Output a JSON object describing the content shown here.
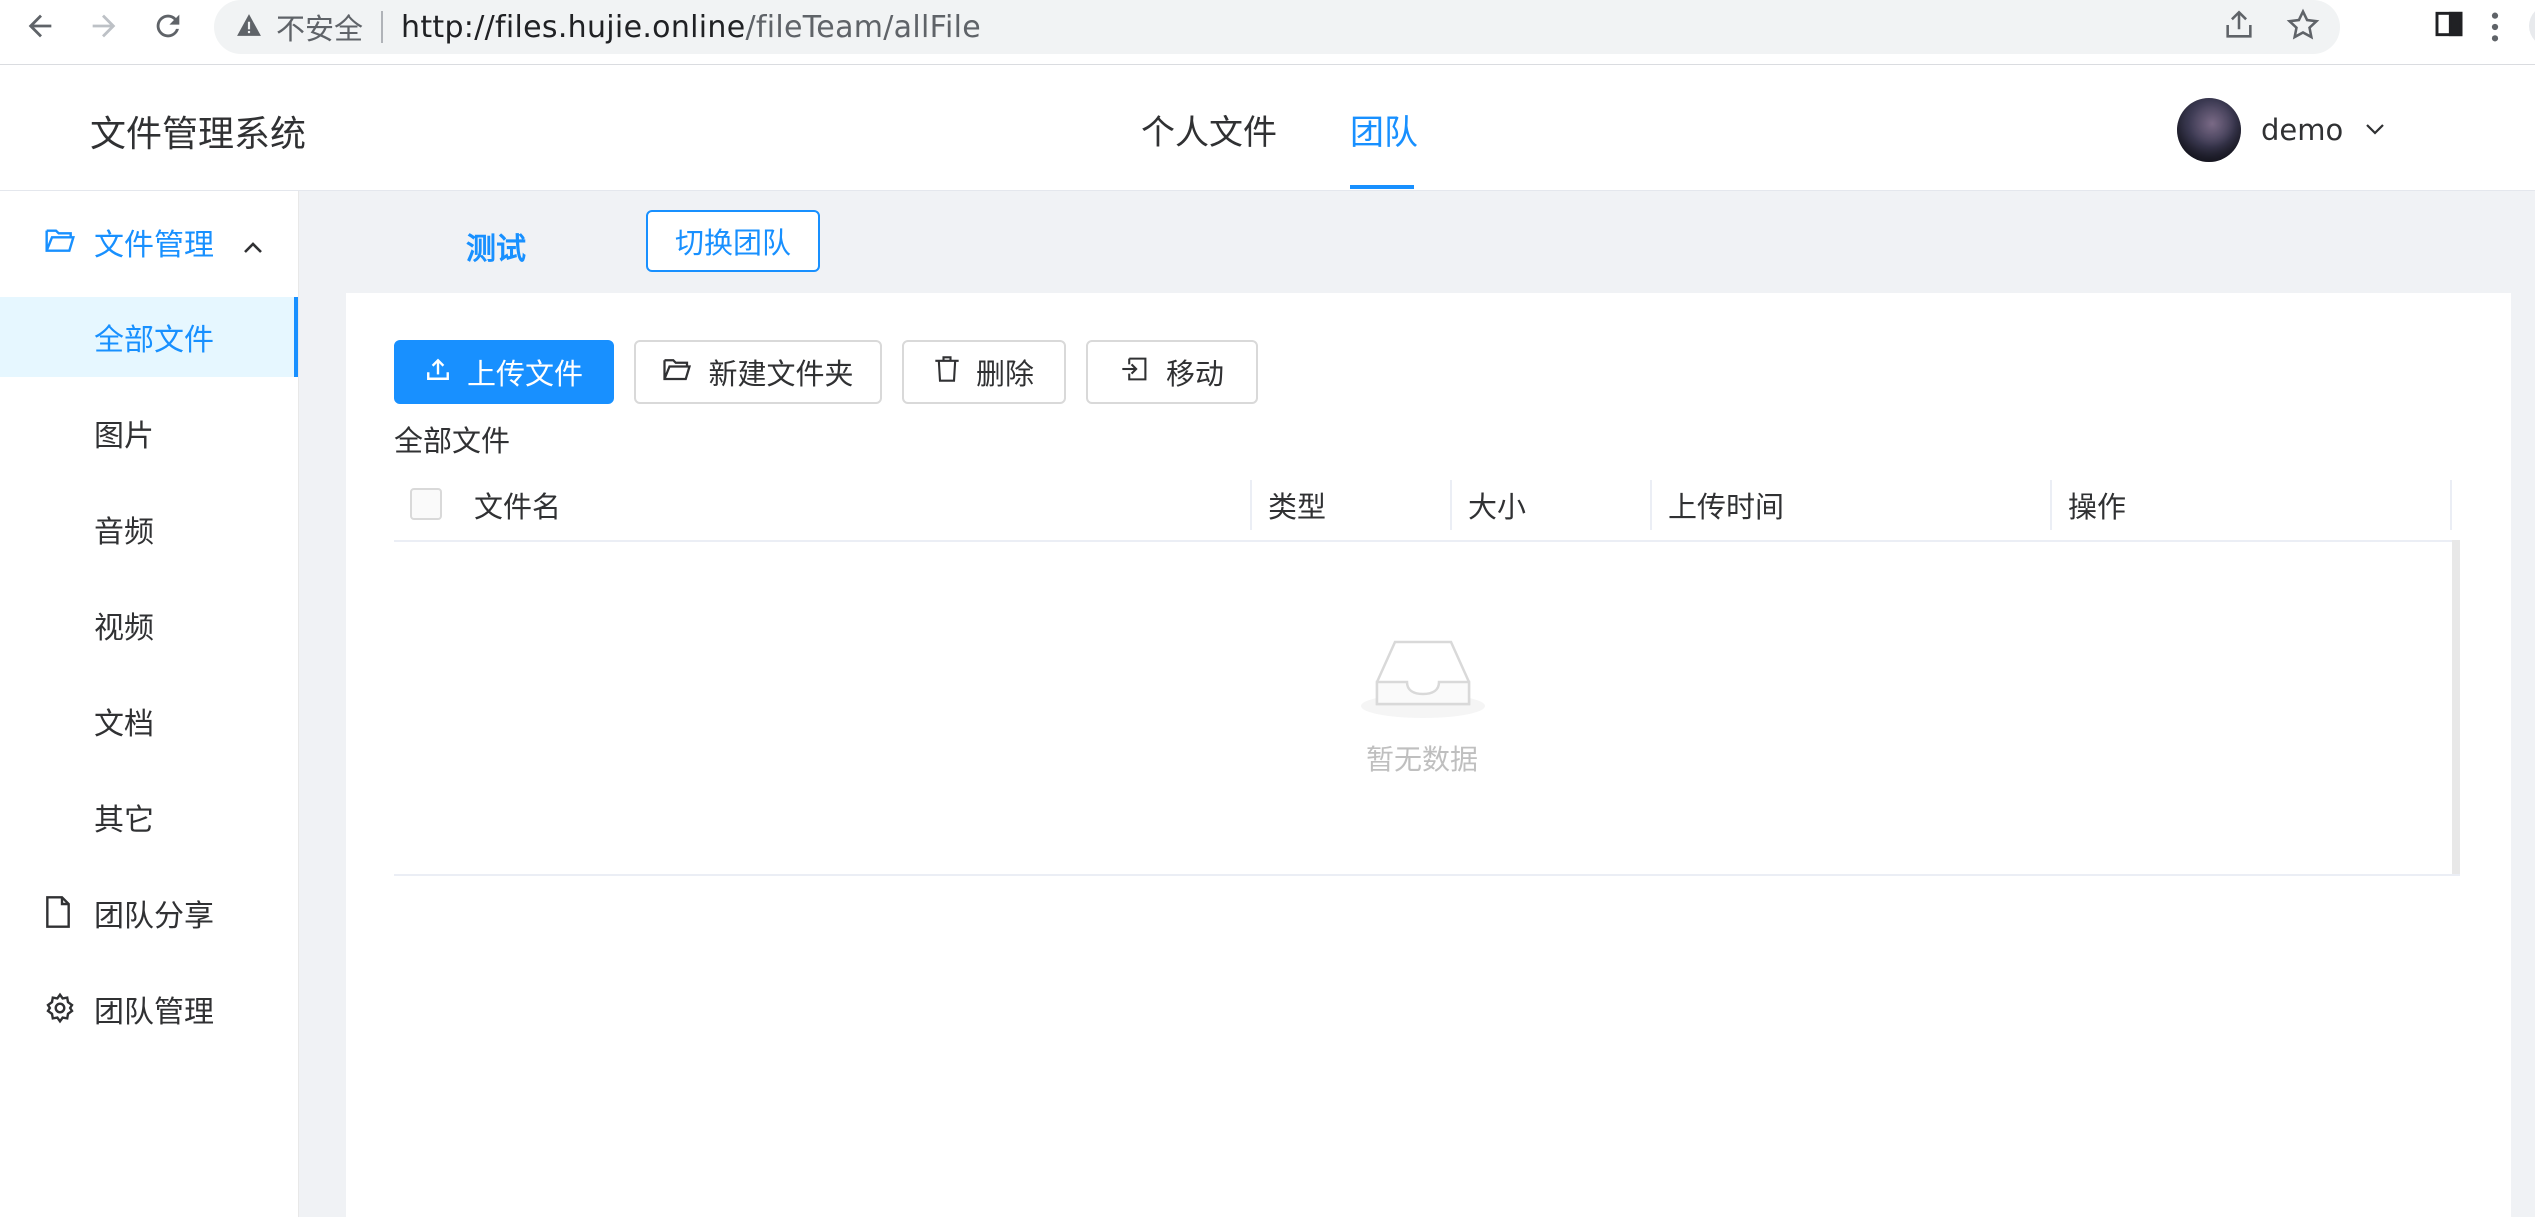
{
  "browser": {
    "security_label": "不安全",
    "url_host": "http://files.hujie.online",
    "url_path": "/fileTeam/allFile"
  },
  "header": {
    "app_title": "文件管理系统",
    "tabs": [
      {
        "label": "个人文件",
        "active": false
      },
      {
        "label": "团队",
        "active": true
      }
    ],
    "user": {
      "name": "demo"
    }
  },
  "sidebar": {
    "groups": [
      {
        "label": "文件管理",
        "icon": "folder-open-icon",
        "expanded": true
      },
      {
        "label": "团队分享",
        "icon": "file-icon"
      },
      {
        "label": "团队管理",
        "icon": "gear-icon"
      }
    ],
    "sub_items": [
      {
        "label": "全部文件",
        "active": true
      },
      {
        "label": "图片"
      },
      {
        "label": "音频"
      },
      {
        "label": "视频"
      },
      {
        "label": "文档"
      },
      {
        "label": "其它"
      }
    ]
  },
  "team": {
    "name": "测试",
    "switch_label": "切换团队"
  },
  "toolbar": {
    "upload_label": "上传文件",
    "new_folder_label": "新建文件夹",
    "delete_label": "删除",
    "move_label": "移动"
  },
  "section_label": "全部文件",
  "table": {
    "columns": [
      "文件名",
      "类型",
      "大小",
      "上传时间",
      "操作"
    ],
    "empty_text": "暂无数据"
  },
  "colors": {
    "primary": "#1890ff",
    "active_bg": "#e6f7ff",
    "content_bg": "#f0f2f5"
  }
}
